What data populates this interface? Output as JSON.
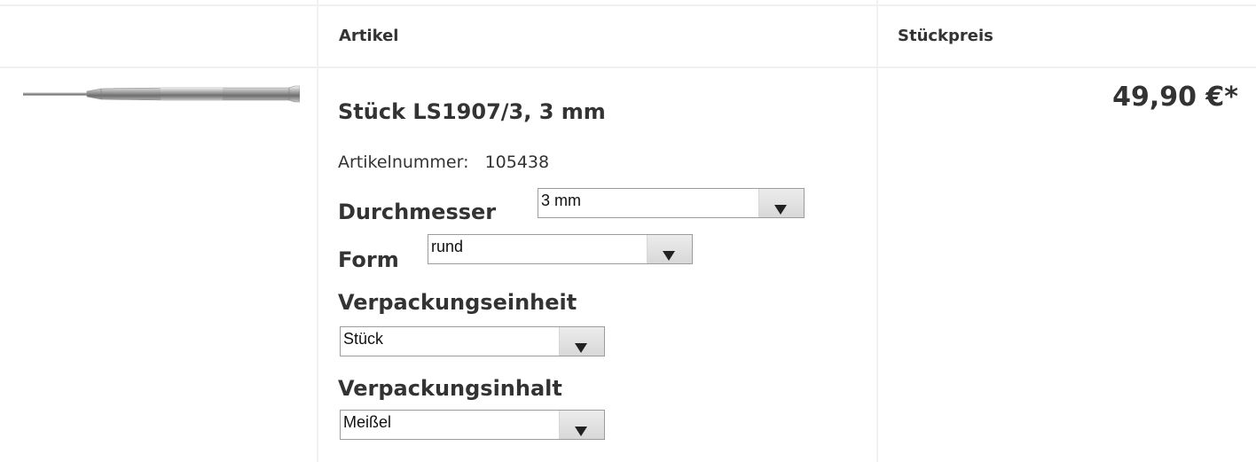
{
  "header": {
    "article_label": "Artikel",
    "price_label": "Stückpreis"
  },
  "product": {
    "image_icon": "chisel-product-image",
    "title": "Stück LS1907/3, 3 mm",
    "article_number_label": "Artikelnummer:",
    "article_number": "105438",
    "price": "49,90 €*"
  },
  "options": {
    "durchmesser": {
      "label": "Durchmesser",
      "value": "3 mm"
    },
    "form": {
      "label": "Form",
      "value": "rund"
    },
    "verpackungseinheit": {
      "label": "Verpackungseinheit",
      "value": "Stück"
    },
    "verpackungsinhalt": {
      "label": "Verpackungsinhalt",
      "value": "Meißel"
    }
  }
}
